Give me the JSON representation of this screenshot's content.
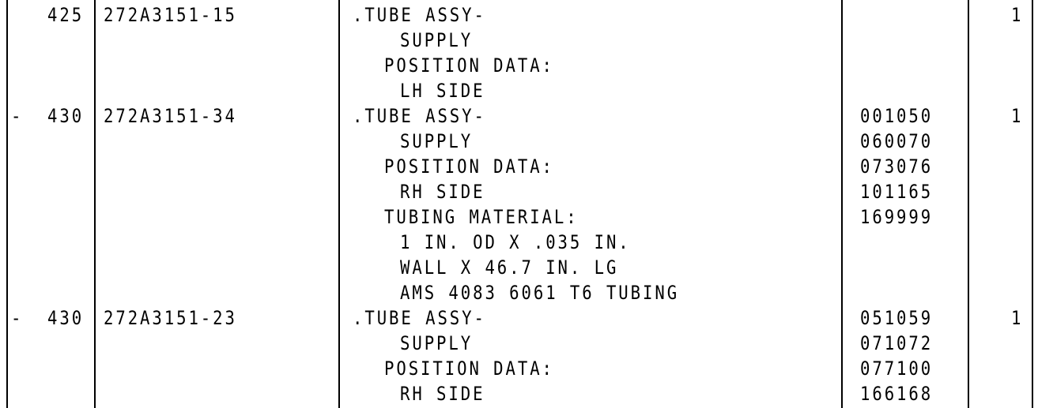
{
  "rows": [
    {
      "item": "425",
      "prefix": "",
      "part_number": "272A3151-15",
      "nomenclature": [
        ".TUBE ASSY-",
        "SUPPLY",
        "POSITION DATA:",
        "LH SIDE"
      ],
      "effectivity": [],
      "units": "1"
    },
    {
      "item": "430",
      "prefix": "-",
      "part_number": "272A3151-34",
      "nomenclature": [
        ".TUBE ASSY-",
        "SUPPLY",
        "POSITION DATA:",
        "RH SIDE",
        "TUBING MATERIAL:",
        "1 IN. OD X .035 IN.",
        "WALL X 46.7 IN. LG",
        "AMS 4083 6061 T6 TUBING"
      ],
      "effectivity": [
        "001050",
        "060070",
        "073076",
        "101165",
        "169999"
      ],
      "units": "1"
    },
    {
      "item": "430",
      "prefix": "-",
      "part_number": "272A3151-23",
      "nomenclature": [
        ".TUBE ASSY-",
        "SUPPLY",
        "POSITION DATA:",
        "RH SIDE"
      ],
      "effectivity": [
        "051059",
        "071072",
        "077100",
        "166168"
      ],
      "units": "1"
    }
  ]
}
